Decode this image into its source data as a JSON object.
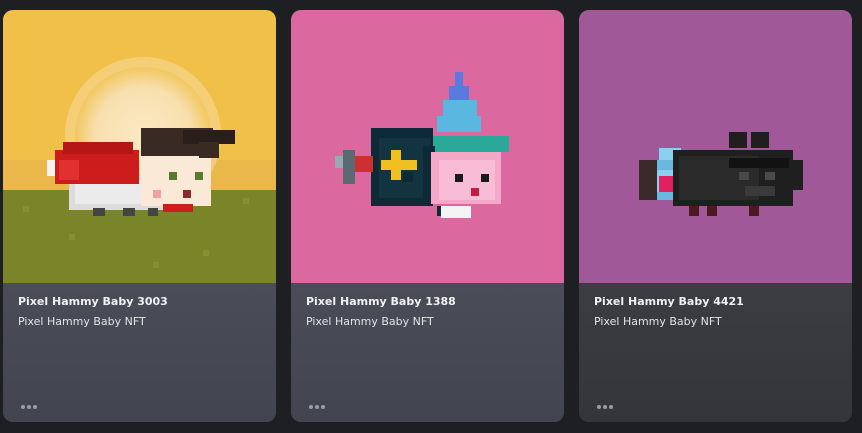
{
  "cards": [
    {
      "title": "Pixel Hammy Baby 3003",
      "subtitle": "Pixel Hammy Baby NFT",
      "background": "#f0c048"
    },
    {
      "title": "Pixel Hammy Baby 1388",
      "subtitle": "Pixel Hammy Baby NFT",
      "background": "#dc68a0"
    },
    {
      "title": "Pixel Hammy Baby 4421",
      "subtitle": "Pixel Hammy Baby NFT",
      "background": "#a05898"
    }
  ],
  "more_icon": "ellipsis-icon"
}
